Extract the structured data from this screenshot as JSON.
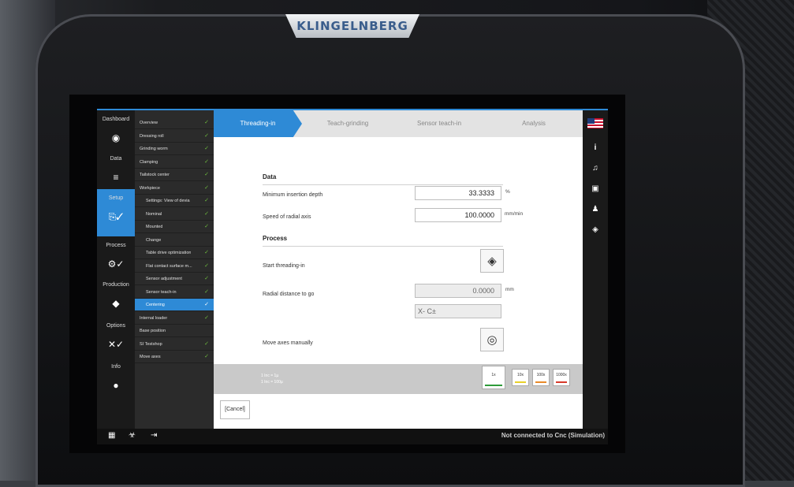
{
  "brand": "KLINGELNBERG",
  "nav": [
    {
      "label": "Dashboard",
      "icon": "gauge-icon",
      "glyph": "◉"
    },
    {
      "label": "Data",
      "icon": "data-icon",
      "glyph": "≡"
    },
    {
      "label": "Setup",
      "icon": "setup-icon",
      "glyph": "⎘✓",
      "active": true
    },
    {
      "label": "Process",
      "icon": "gears-icon",
      "glyph": "⚙✓"
    },
    {
      "label": "Production",
      "icon": "production-icon",
      "glyph": "◆"
    },
    {
      "label": "Options",
      "icon": "tools-icon",
      "glyph": "✕✓"
    },
    {
      "label": "Info",
      "icon": "info-icon",
      "glyph": "●"
    }
  ],
  "subnav": [
    {
      "label": "Overview",
      "check": true
    },
    {
      "label": "Dressing roll",
      "check": true
    },
    {
      "label": "Grinding worm",
      "check": true
    },
    {
      "label": "Clamping",
      "check": true
    },
    {
      "label": "Tailstock center",
      "check": true
    },
    {
      "label": "Workpiece",
      "check": true
    },
    {
      "label": "Settings: View of devia",
      "check": true,
      "indent": true
    },
    {
      "label": "Nominal",
      "check": true,
      "indent": true
    },
    {
      "label": "Mounted",
      "check": true,
      "indent": true
    },
    {
      "label": "Change",
      "check": false,
      "indent": true
    },
    {
      "label": "Table drive optimization",
      "check": true,
      "indent": true
    },
    {
      "label": "Flat contact surface m...",
      "check": true,
      "indent": true
    },
    {
      "label": "Sensor adjustment",
      "check": true,
      "indent": true
    },
    {
      "label": "Sensor teach-in",
      "check": true,
      "indent": true
    },
    {
      "label": "Centering",
      "check": true,
      "indent": true,
      "active": true
    },
    {
      "label": "Internal loader",
      "check": true
    },
    {
      "label": "Base position",
      "check": false
    },
    {
      "label": "SI Testshop",
      "check": true
    },
    {
      "label": "Move axes",
      "check": true
    }
  ],
  "tabs": [
    "Threading-in",
    "Teach-grinding",
    "Sensor teach-in",
    "Analysis"
  ],
  "form": {
    "section_data": "Data",
    "min_insertion_label": "Minimum insertion depth",
    "min_insertion_value": "33.3333",
    "min_insertion_unit": "%",
    "radial_speed_label": "Speed of radial axis",
    "radial_speed_value": "100.0000",
    "radial_speed_unit": "mm/min",
    "section_process": "Process",
    "start_threading_label": "Start threading-in",
    "radial_distance_label": "Radial distance to go",
    "radial_distance_value": "0.0000",
    "radial_distance_unit": "mm",
    "axes_value": "X- C±",
    "move_axes_label": "Move axes manually"
  },
  "bottom": {
    "line1": "1 Inc = 1µ",
    "line2": "1 Inc = 100µ",
    "speeds": [
      {
        "label": "1x",
        "color": "#2e9b3a",
        "selected": true
      },
      {
        "label": "10x",
        "color": "#e8d02a"
      },
      {
        "label": "100x",
        "color": "#e88a2a"
      },
      {
        "label": "1000x",
        "color": "#d63a2a"
      }
    ]
  },
  "cancel_label": "[Cancel]",
  "status_text": "Not connected to Cnc (Simulation)",
  "accent": "#2e8ad6"
}
